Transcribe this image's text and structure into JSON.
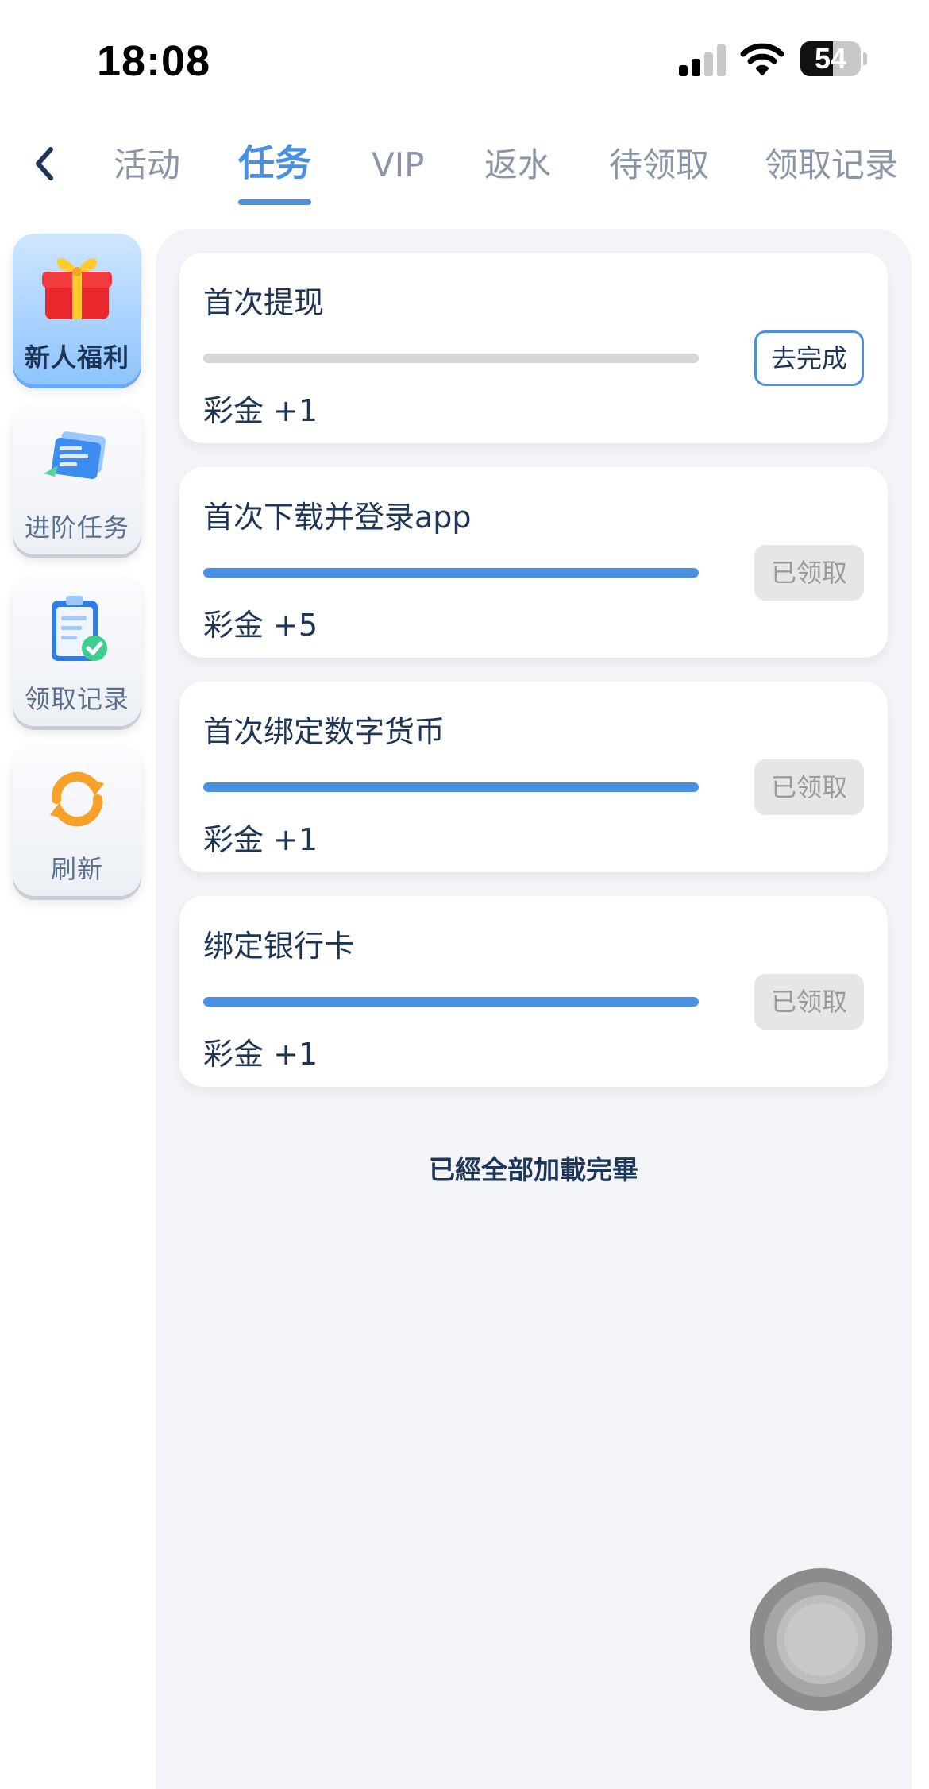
{
  "status_bar": {
    "time": "18:08",
    "battery": "54",
    "signal_bars_active": 2,
    "signal_bars_total": 4
  },
  "nav": {
    "back_icon": "chevron-left-icon",
    "tabs": [
      {
        "label": "活动",
        "active": false
      },
      {
        "label": "任务",
        "active": true
      },
      {
        "label": "VIP",
        "active": false
      },
      {
        "label": "返水",
        "active": false
      },
      {
        "label": "待领取",
        "active": false
      },
      {
        "label": "领取记录",
        "active": false
      }
    ]
  },
  "sidebar": {
    "items": [
      {
        "label": "新人福利",
        "icon": "gift-icon",
        "active": true
      },
      {
        "label": "进阶任务",
        "icon": "task-cards-icon",
        "active": false
      },
      {
        "label": "领取记录",
        "icon": "clipboard-check-icon",
        "active": false
      },
      {
        "label": "刷新",
        "icon": "refresh-icon",
        "active": false
      }
    ]
  },
  "tasks": [
    {
      "title": "首次提现",
      "reward": "彩金 +1",
      "progress": 0,
      "button": "去完成",
      "status": "go"
    },
    {
      "title": "首次下载并登录app",
      "reward": "彩金 +5",
      "progress": 1,
      "button": "已领取",
      "status": "done"
    },
    {
      "title": "首次绑定数字货币",
      "reward": "彩金 +1",
      "progress": 1,
      "button": "已领取",
      "status": "done"
    },
    {
      "title": "绑定银行卡",
      "reward": "彩金 +1",
      "progress": 1,
      "button": "已领取",
      "status": "done"
    }
  ],
  "footer": {
    "end_text": "已經全部加載完畢"
  },
  "colors": {
    "accent": "#4a90e2",
    "text_dark": "#1d3557",
    "tab_inactive": "#8a96a8",
    "panel_bg": "#f2f4f7",
    "claimed_button_bg": "#e6e6e6"
  }
}
